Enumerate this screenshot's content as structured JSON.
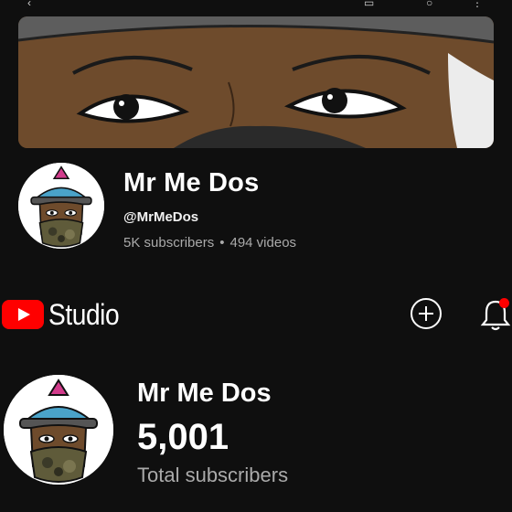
{
  "channel": {
    "name": "Mr Me Dos",
    "handle": "@MrMeDos",
    "subscribers": "5K subscribers",
    "separator": "•",
    "videos": "494 videos"
  },
  "studio": {
    "logo_text": "Studio",
    "create_icon": "plus-circle-icon",
    "notifications_icon": "bell-icon",
    "notification_badge_color": "#ff0000"
  },
  "summary": {
    "channel_name": "Mr Me Dos",
    "subscriber_count": "5,001",
    "subscriber_label": "Total subscribers"
  },
  "colors": {
    "background": "#0f0f0f",
    "youtube_red": "#ff0000",
    "secondary_text": "#aaaaaa"
  }
}
